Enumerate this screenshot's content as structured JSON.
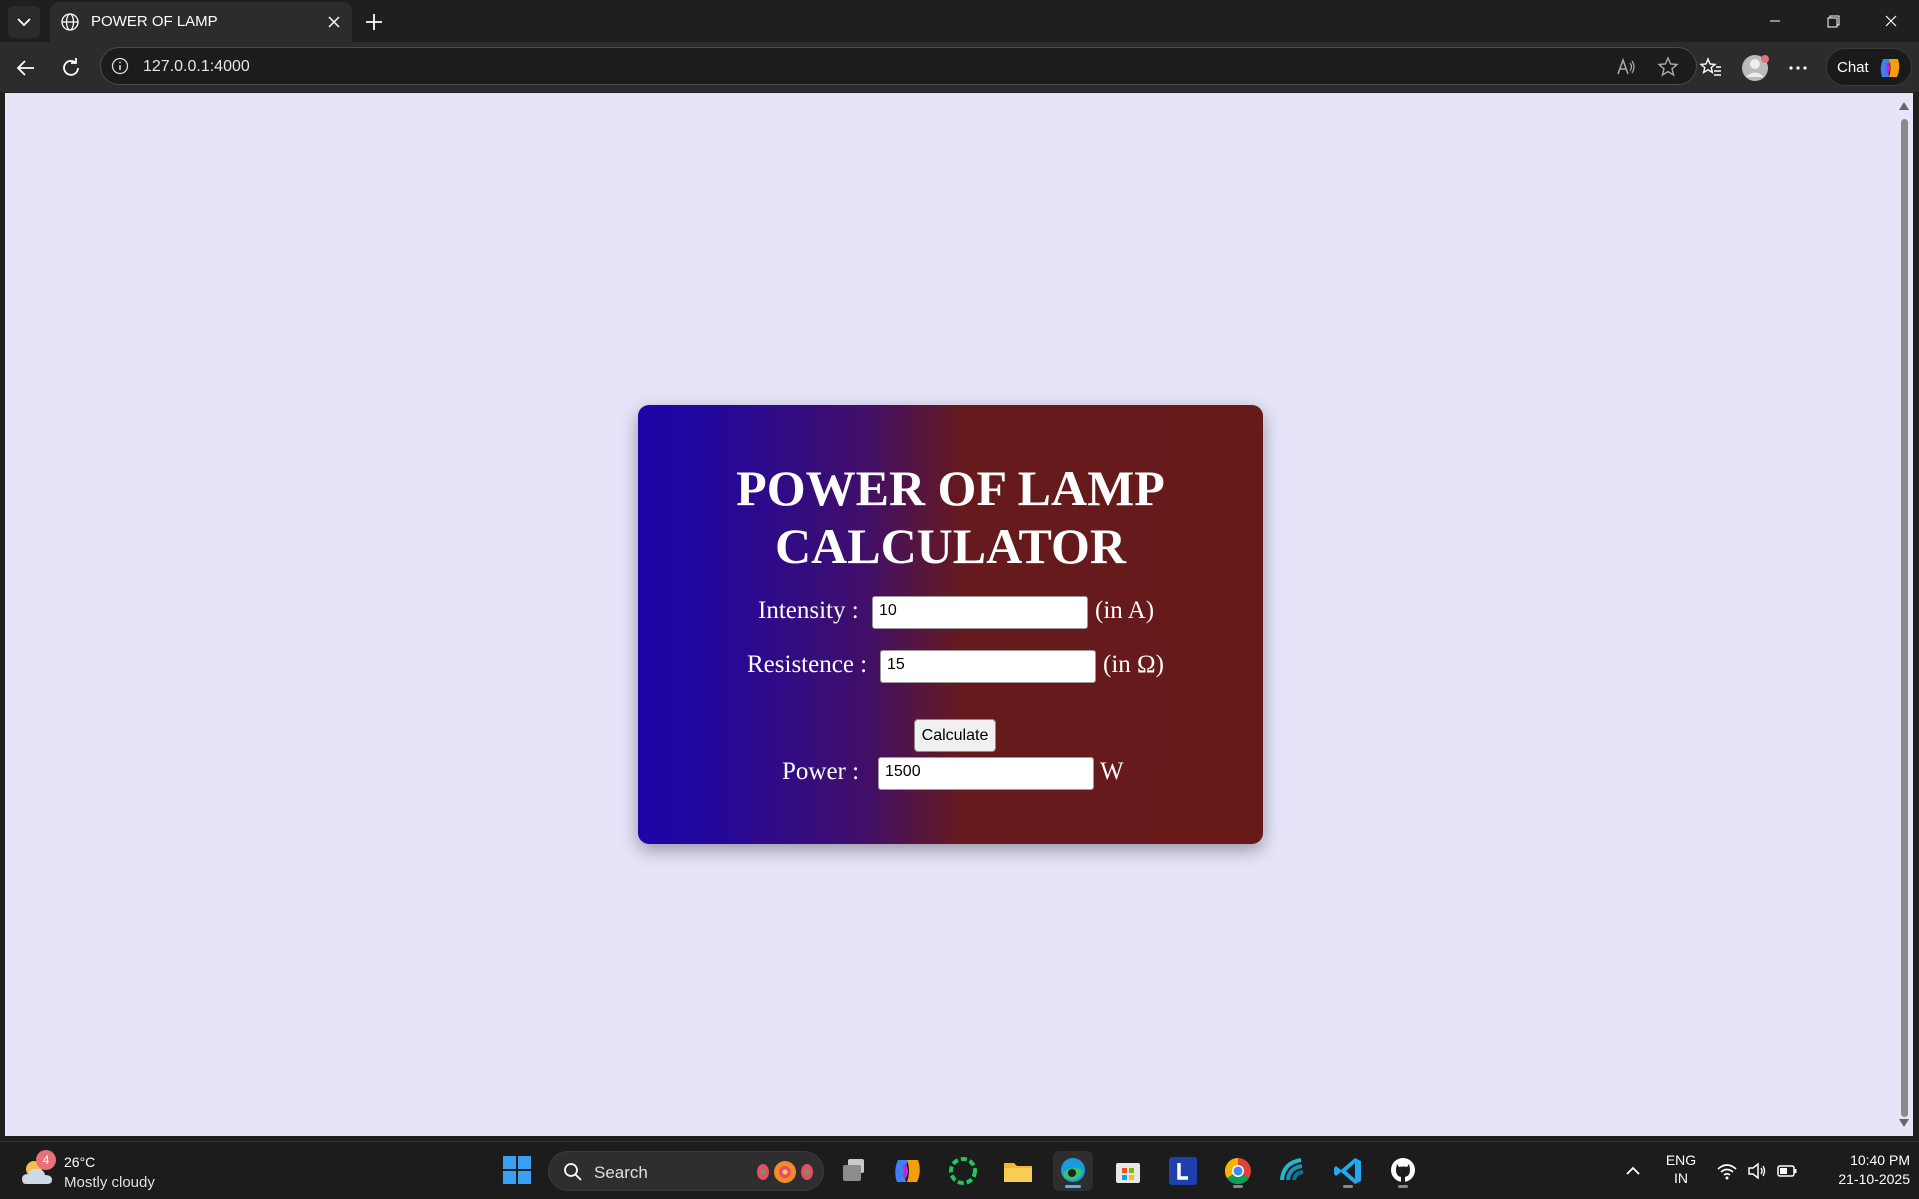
{
  "browser": {
    "tab_title": "POWER OF LAMP",
    "url": "127.0.0.1:4000",
    "chat_label": "Chat"
  },
  "calculator": {
    "title_line1": "POWER OF LAMP",
    "title_line2": "CALCULATOR",
    "intensity_label": "Intensity :",
    "intensity_value": "10",
    "intensity_unit": "(in A)",
    "resistance_label": "Resistence :",
    "resistance_value": "15",
    "resistance_unit": "(in Ω)",
    "calculate_label": "Calculate",
    "power_label": "Power :",
    "power_value": "1500",
    "power_unit": "W"
  },
  "taskbar": {
    "weather_badge": "4",
    "weather_temp": "26°C",
    "weather_desc": "Mostly cloudy",
    "search_label": "Search",
    "lang_line1": "ENG",
    "lang_line2": "IN",
    "time": "10:40 PM",
    "date": "21-10-2025"
  },
  "colors": {
    "page_background": "#e6e4f9",
    "card_gradient_start": "#1d06a8",
    "card_gradient_end": "#681a1a"
  }
}
